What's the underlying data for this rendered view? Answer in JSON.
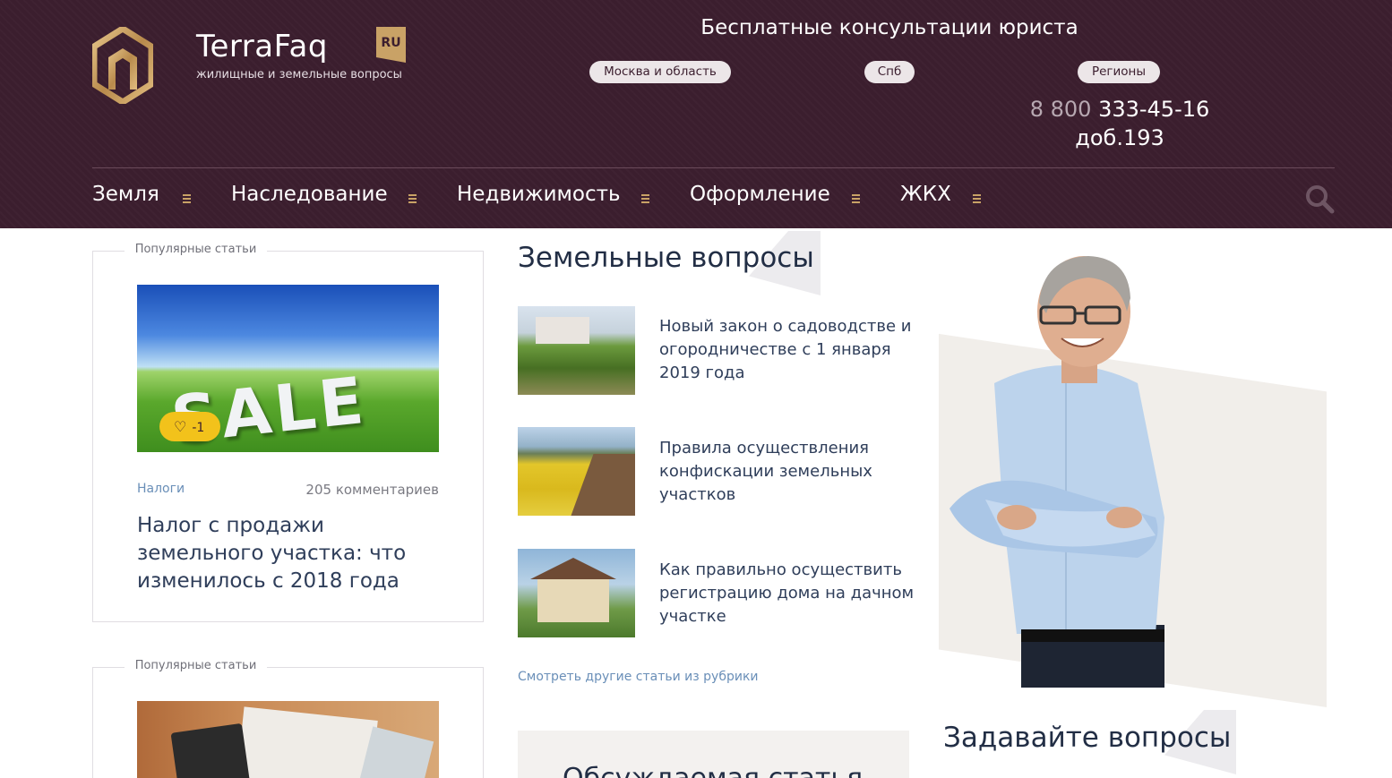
{
  "header": {
    "brand": "TerraFaq",
    "tagline": "жилищные и земельные вопросы",
    "lang_badge": "RU",
    "consult_title": "Бесплатные консультации юриста",
    "regions": [
      "Москва и область",
      "Спб",
      "Регионы"
    ],
    "phone_prefix": "8 800",
    "phone_number": "333-45-16",
    "phone_ext": "доб.193"
  },
  "nav": {
    "items": [
      "Земля",
      "Наследование",
      "Недвижимость",
      "Оформление",
      "ЖКХ"
    ]
  },
  "popular": {
    "label": "Популярные статьи",
    "card1": {
      "image_text": "SALE",
      "likes": "-1",
      "category": "Налоги",
      "comments": "205 комментариев",
      "title": "Налог с продажи земельного участка: что изменилось с 2018 года"
    },
    "card2": {
      "label": "Популярные статьи"
    }
  },
  "land": {
    "title": "Земельные вопросы",
    "articles": [
      "Новый закон о садоводстве и огородничестве с 1 января 2019 года",
      "Правила осуществления конфискации земельных участков",
      "Как правильно осуществить регистрацию дома на дачном участке"
    ],
    "more_link": "Смотреть другие статьи из рубрики"
  },
  "discussed": {
    "title": "Обсуждаемая статья"
  },
  "ask": {
    "title": "Задавайте вопросы"
  },
  "colors": {
    "header_bg": "#3b1e2e",
    "accent_gold": "#c9a266",
    "like_yellow": "#f2c21b",
    "link_blue": "#6a8fb8"
  }
}
